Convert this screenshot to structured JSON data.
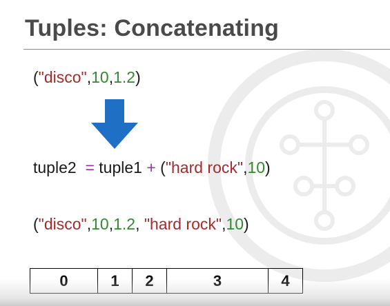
{
  "slide": {
    "title": "Tuples: Concatenating",
    "line1": {
      "open": "(",
      "s1": "\"disco\"",
      "c1": ",",
      "n1": "10",
      "c2": ",",
      "n2": "1.2",
      "close": ")"
    },
    "line2": {
      "lhs": "tuple2",
      "eq": "=",
      "rhs": "tuple1",
      "plus": "+",
      "open": "(",
      "s1": "\"hard rock\"",
      "c1": ",",
      "n1": "10",
      "close": ")"
    },
    "line3": {
      "open": "(",
      "s1": "\"disco\"",
      "c1": ",",
      "n1": "10",
      "c2": ",",
      "n2": "1.2",
      "c3": ", ",
      "s2": "\"hard rock\"",
      "c4": ",",
      "n3": "10",
      "close": ")"
    },
    "indexes": [
      "0",
      "1",
      "2",
      "3",
      "4"
    ]
  },
  "colors": {
    "string": "#a52a2a",
    "number": "#2e8b2e",
    "operator": "#9b2fae",
    "arrow": "#1f6fc4",
    "title": "#4a4a4a"
  },
  "icons": {
    "arrow": "arrow-down-icon",
    "watermark": "network-circle-icon"
  }
}
